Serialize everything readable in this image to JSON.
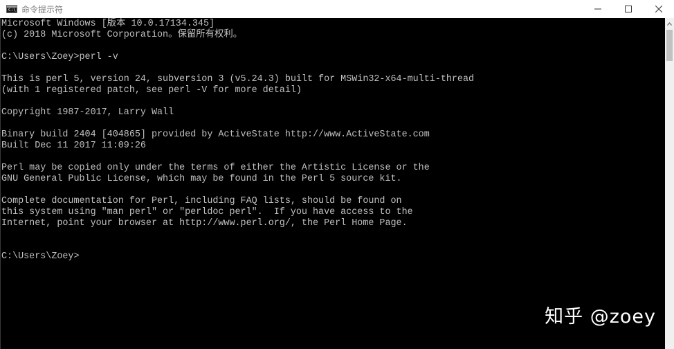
{
  "window": {
    "title": "命令提示符",
    "icon": "cmd-icon",
    "controls": [
      "minimize-icon",
      "maximize-icon",
      "close-icon"
    ]
  },
  "console": {
    "lines": [
      "Microsoft Windows [版本 10.0.17134.345]",
      "(c) 2018 Microsoft Corporation。保留所有权利。",
      "",
      "C:\\Users\\Zoey>perl -v",
      "",
      "This is perl 5, version 24, subversion 3 (v5.24.3) built for MSWin32-x64-multi-thread",
      "(with 1 registered patch, see perl -V for more detail)",
      "",
      "Copyright 1987-2017, Larry Wall",
      "",
      "Binary build 2404 [404865] provided by ActiveState http://www.ActiveState.com",
      "Built Dec 11 2017 11:09:26",
      "",
      "Perl may be copied only under the terms of either the Artistic License or the",
      "GNU General Public License, which may be found in the Perl 5 source kit.",
      "",
      "Complete documentation for Perl, including FAQ lists, should be found on",
      "this system using \"man perl\" or \"perldoc perl\".  If you have access to the",
      "Internet, point your browser at http://www.perl.org/, the Perl Home Page.",
      "",
      "",
      "C:\\Users\\Zoey>"
    ],
    "text_color": "#c0c0c0",
    "background_color": "#000000"
  },
  "watermark": {
    "text": "知乎 @zoey"
  }
}
